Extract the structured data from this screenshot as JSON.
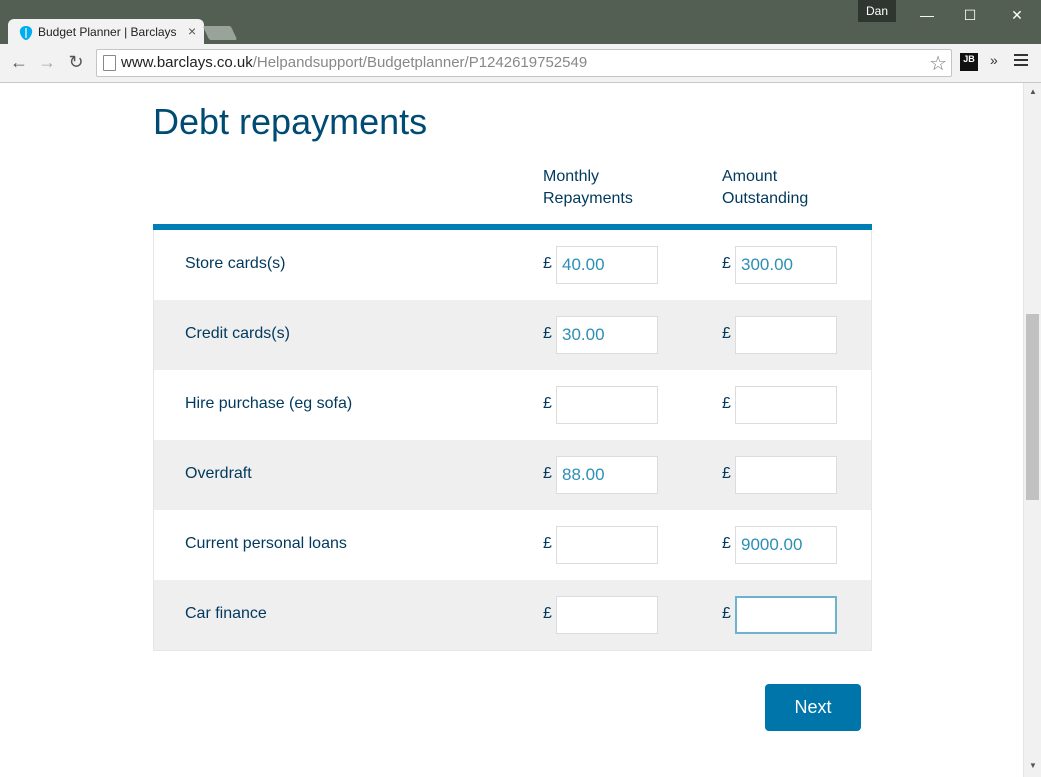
{
  "browser": {
    "tab_title": "Budget Planner | Barclays",
    "tab_close": "×",
    "user": "Dan",
    "url_host": "www.barclays.co.uk",
    "url_path": "/Helpandsupport/Budgetplanner/P1242619752549",
    "extension_label": "JB",
    "overflow_label": "»"
  },
  "page": {
    "title": "Debt repayments",
    "columns": {
      "monthly_line1": "Monthly",
      "monthly_line2": "Repayments",
      "outstanding_line1": "Amount",
      "outstanding_line2": "Outstanding"
    },
    "currency": "£",
    "rows": [
      {
        "label": "Store cards(s)",
        "monthly": "40.00",
        "outstanding": "300.00"
      },
      {
        "label": "Credit cards(s)",
        "monthly": "30.00",
        "outstanding": ""
      },
      {
        "label": "Hire purchase (eg sofa)",
        "monthly": "",
        "outstanding": ""
      },
      {
        "label": "Overdraft",
        "monthly": "88.00",
        "outstanding": ""
      },
      {
        "label": "Current personal loans",
        "monthly": "",
        "outstanding": "9000.00"
      },
      {
        "label": "Car finance",
        "monthly": "",
        "outstanding": ""
      }
    ],
    "next_label": "Next"
  },
  "colors": {
    "heading": "#004b73",
    "accent_rule": "#007eb6",
    "button": "#0075a9",
    "input_text": "#2d8fb5"
  }
}
